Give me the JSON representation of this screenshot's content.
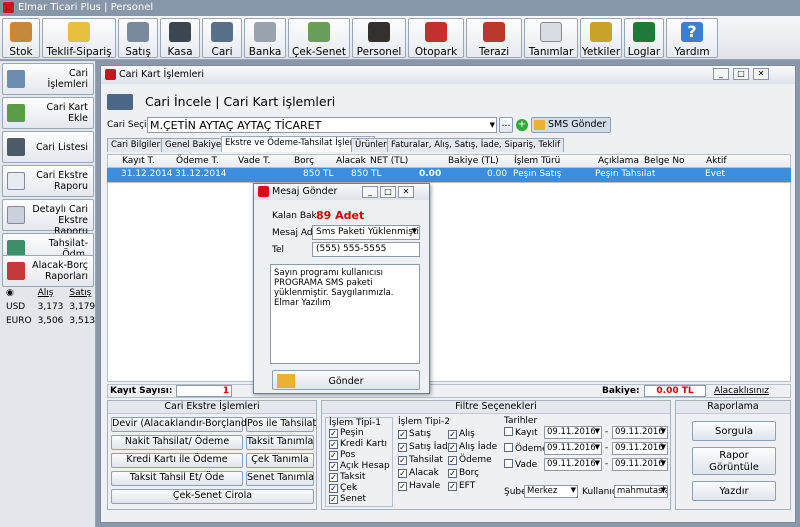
{
  "app": {
    "title": "Elmar Ticari Plus | Personel"
  },
  "toolbar": [
    "Stok",
    "Teklif-Sipariş",
    "Satış",
    "Kasa",
    "Cari",
    "Banka",
    "Çek-Senet",
    "Personel",
    "Otopark",
    "Terazi",
    "Tanımlar",
    "Yetkiler",
    "Loglar",
    "Yardım"
  ],
  "sidebar": [
    "Cari İşlemleri",
    "Cari Kart Ekle",
    "Cari Listesi",
    "Cari Ekstre Raporu",
    "Detaylı Cari Ekstre Raporu",
    "Tahsilat-Ödm. Raporları",
    "Alacak-Borç Raporları"
  ],
  "fx": {
    "h1": "Alış",
    "h2": "Satış",
    "rows": [
      [
        "USD",
        "3,173",
        "3,179"
      ],
      [
        "EURO",
        "3,506",
        "3,513"
      ]
    ]
  },
  "win": {
    "title": "Cari Kart İşlemleri",
    "heading": "Cari İncele | Cari Kart işlemleri",
    "select_label": "Cari Seçimi",
    "select_value": "M.ÇETİN AYTAÇ AYTAÇ TİCARET",
    "dots": "...",
    "sms_button": "SMS Gönder"
  },
  "tabs": [
    "Cari Bilgileri",
    "Genel Bakiyeler",
    "Ekstre ve Ödeme-Tahsilat İşlemleri",
    "Ürünler",
    "Faturalar, Alış, Satış, İade, Sipariş, Teklif"
  ],
  "grid": {
    "headers": [
      "Kayıt T.",
      "Ödeme T.",
      "Vade T.",
      "Borç",
      "Alacak",
      "NET (TL)",
      "Bakiye (TL)",
      "İşlem Türü",
      "Açıklama",
      "Belge No",
      "Aktif"
    ],
    "row": [
      "31.12.2014",
      "31.12.2014",
      "",
      "850 TL",
      "850 TL",
      "0.00",
      "0.00",
      "Peşin Satış",
      "Peşin Tahsilat",
      "",
      "Evet"
    ]
  },
  "summary": {
    "count_label": "Kayıt Sayısı:",
    "count": "1",
    "balance_label": "Bakiye:",
    "balance": "0.00 TL",
    "link": "Alacaklısınız"
  },
  "ekstre": {
    "title": "Cari Ekstre İşlemleri",
    "buttons": [
      "Devir (Alacaklandır-Borçlandır)",
      "Pos ile Tahsilat",
      "Nakit Tahsilat/ Ödeme",
      "Taksit Tanımla",
      "Kredi Kartı ile Ödeme",
      "Çek Tanımla",
      "Taksit Tahsil Et/ Öde",
      "Senet Tanımla",
      "Çek-Senet Cirola"
    ]
  },
  "filter": {
    "title": "Filtre Seçenekleri",
    "t1": "İşlem Tipi-1",
    "t1_items": [
      "Peşin",
      "Kredi Kartı",
      "Pos",
      "Açık Hesap",
      "Taksit",
      "Çek",
      "Senet"
    ],
    "t2": "İşlem Tipi-2",
    "t2a": [
      "Satış",
      "Satış İade",
      "Tahsilat",
      "Alacak",
      "Havale"
    ],
    "t2b": [
      "Alış",
      "Alış İade",
      "Ödeme",
      "Borç",
      "EFT"
    ],
    "dates_title": "Tarihler",
    "dates": [
      {
        "label": "Kayıt",
        "from": "09.11.2016",
        "to": "09.11.2016"
      },
      {
        "label": "Ödeme",
        "from": "09.11.2016",
        "to": "09.11.2016"
      },
      {
        "label": "Vade",
        "from": "09.11.2016",
        "to": "09.11.2016"
      }
    ],
    "sube_label": "Şube",
    "sube": "Merkez",
    "kull_label": "Kullanıcı",
    "kull": "mahmutasla"
  },
  "report": {
    "title": "Raporlama",
    "buttons": [
      "Sorgula",
      "Rapor Görüntüle",
      "Yazdır"
    ]
  },
  "dialog": {
    "title": "Mesaj Gönder",
    "kb_label": "Kalan Bak.",
    "kb_value": "89 Adet",
    "msg_label": "Mesaj Adı",
    "msg_value": "Sms Paketi Yüklenmiştir",
    "tel_label": "Tel",
    "tel_value": "(555) 555-5555",
    "text": "Sayın programı kullanıcısı PROGRAMA SMS paketi yüklenmiştir. Saygılarımızla. Elmar Yazılım",
    "send": "Gönder"
  }
}
